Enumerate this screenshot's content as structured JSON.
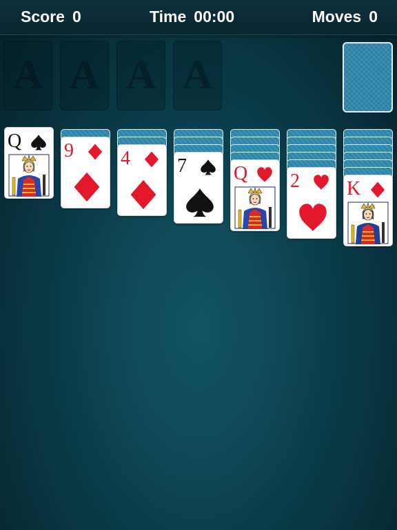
{
  "header": {
    "score_label": "Score",
    "score_value": "0",
    "time_label": "Time",
    "time_value": "00:00",
    "moves_label": "Moves",
    "moves_value": "0"
  },
  "foundations": [
    {
      "label": "A"
    },
    {
      "label": "A"
    },
    {
      "label": "A"
    },
    {
      "label": "A"
    }
  ],
  "stock": {
    "state": "face-down"
  },
  "tableau": [
    {
      "hidden": 0,
      "card": {
        "rank": "Q",
        "suit": "spade",
        "color": "black",
        "face": true
      }
    },
    {
      "hidden": 1,
      "card": {
        "rank": "9",
        "suit": "diamond",
        "color": "red",
        "face": false
      }
    },
    {
      "hidden": 2,
      "card": {
        "rank": "4",
        "suit": "diamond",
        "color": "red",
        "face": false
      }
    },
    {
      "hidden": 3,
      "card": {
        "rank": "7",
        "suit": "spade",
        "color": "black",
        "face": false
      }
    },
    {
      "hidden": 4,
      "card": {
        "rank": "Q",
        "suit": "heart",
        "color": "red",
        "face": true
      }
    },
    {
      "hidden": 5,
      "card": {
        "rank": "2",
        "suit": "heart",
        "color": "red",
        "face": false
      }
    },
    {
      "hidden": 6,
      "card": {
        "rank": "K",
        "suit": "diamond",
        "color": "red",
        "face": true
      }
    }
  ],
  "colors": {
    "red": "#e3182d",
    "black": "#111111",
    "card_back": "#2b86ac",
    "felt": "#0c4452"
  }
}
